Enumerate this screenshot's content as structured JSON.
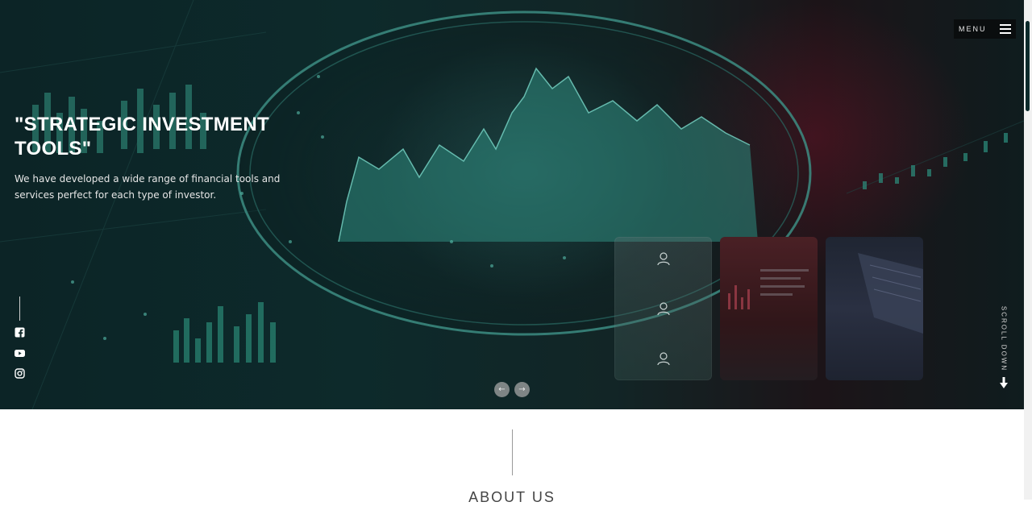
{
  "header": {
    "menu_label": "MENU"
  },
  "hero": {
    "title": "\"STRATEGIC INVESTMENT TOOLS\"",
    "description": "We have developed a wide range of financial tools and services perfect for each type of investor."
  },
  "social": [
    "facebook-icon",
    "youtube-icon",
    "instagram-icon"
  ],
  "slider": {
    "prev_icon": "←",
    "next_icon": "→"
  },
  "scroll_down": {
    "label": "SCROLL DOWN"
  },
  "about": {
    "heading": "ABOUT US"
  },
  "colors": {
    "hero_tint": "#0d2a2b",
    "accent": "#3fb0a0",
    "menu_bg": "#0a0d0e"
  }
}
